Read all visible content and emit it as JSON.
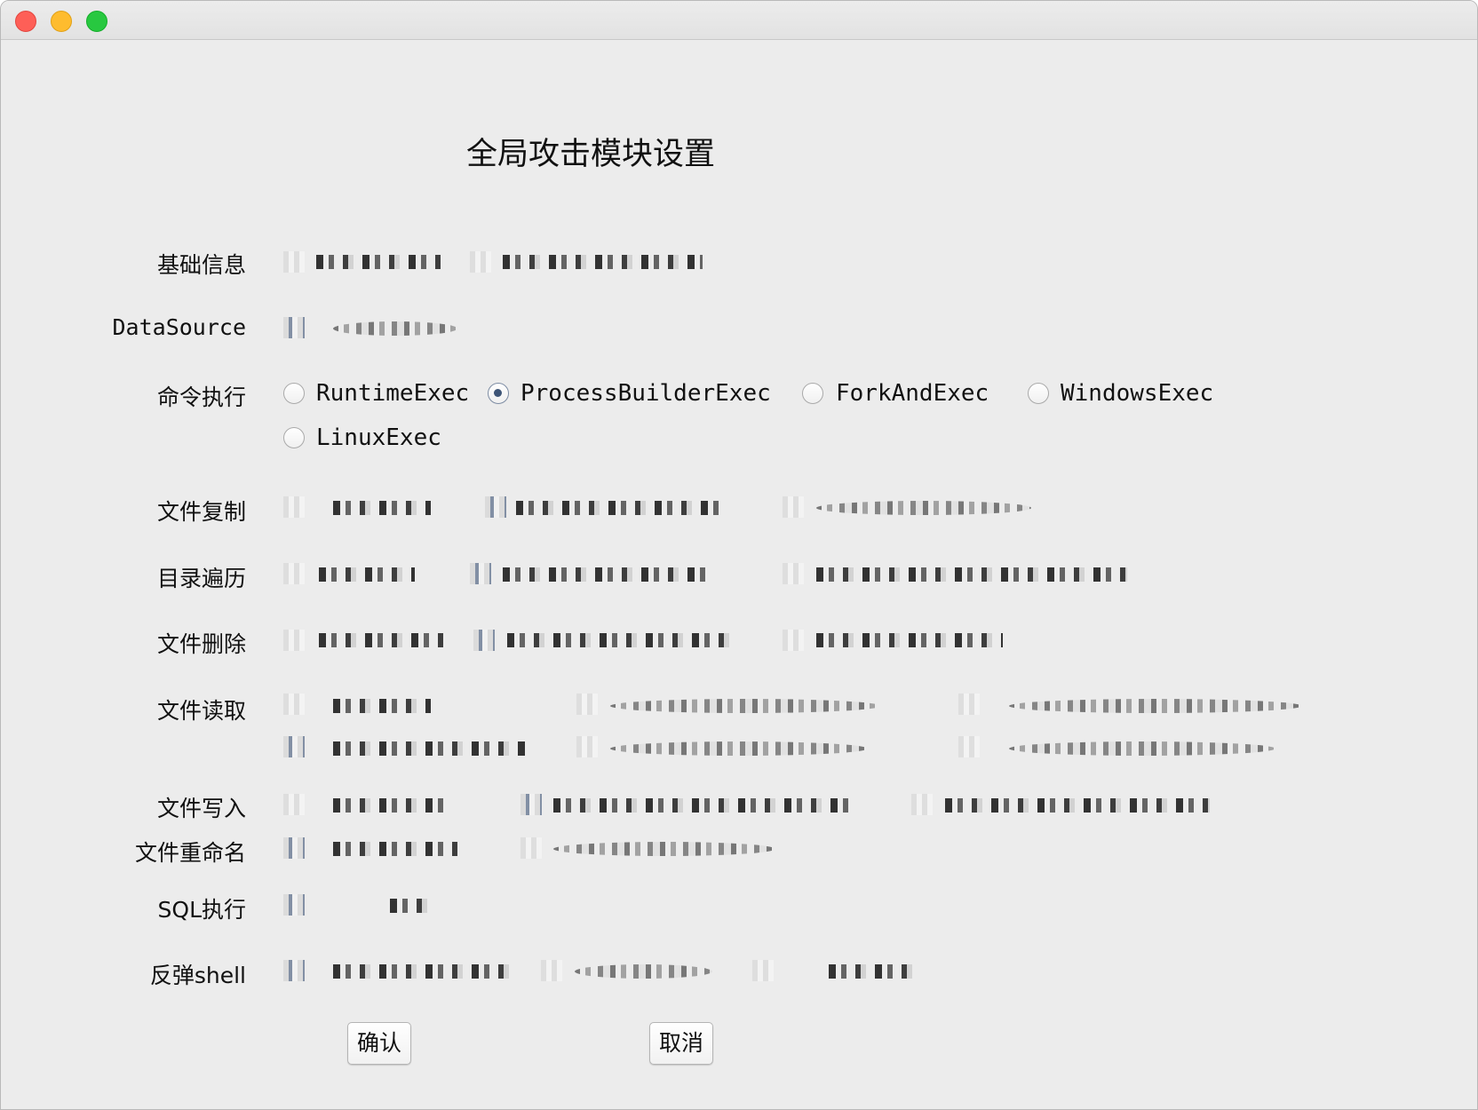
{
  "dialog": {
    "heading": "全局攻击模块设置"
  },
  "rows": {
    "basic_info": {
      "label": "基础信息"
    },
    "datasource": {
      "label": "DataSource"
    },
    "command_exec": {
      "label": "命令执行",
      "options": [
        "RuntimeExec",
        "ProcessBuilderExec",
        "ForkAndExec",
        "WindowsExec",
        "LinuxExec"
      ],
      "selected": "ProcessBuilderExec"
    },
    "file_copy": {
      "label": "文件复制"
    },
    "dir_traverse": {
      "label": "目录遍历"
    },
    "file_delete": {
      "label": "文件删除"
    },
    "file_read": {
      "label": "文件读取"
    },
    "file_write": {
      "label": "文件写入"
    },
    "file_rename": {
      "label": "文件重命名"
    },
    "sql_exec": {
      "label": "SQL执行"
    },
    "reverse_shell": {
      "label": "反弹shell"
    }
  },
  "buttons": {
    "confirm": "确认",
    "cancel": "取消"
  },
  "colors": {
    "window_bg": "#ececec",
    "radio_selected": "#3e5577",
    "close": "#fe5f57",
    "minimize": "#febc2e",
    "maximize": "#28c840"
  }
}
